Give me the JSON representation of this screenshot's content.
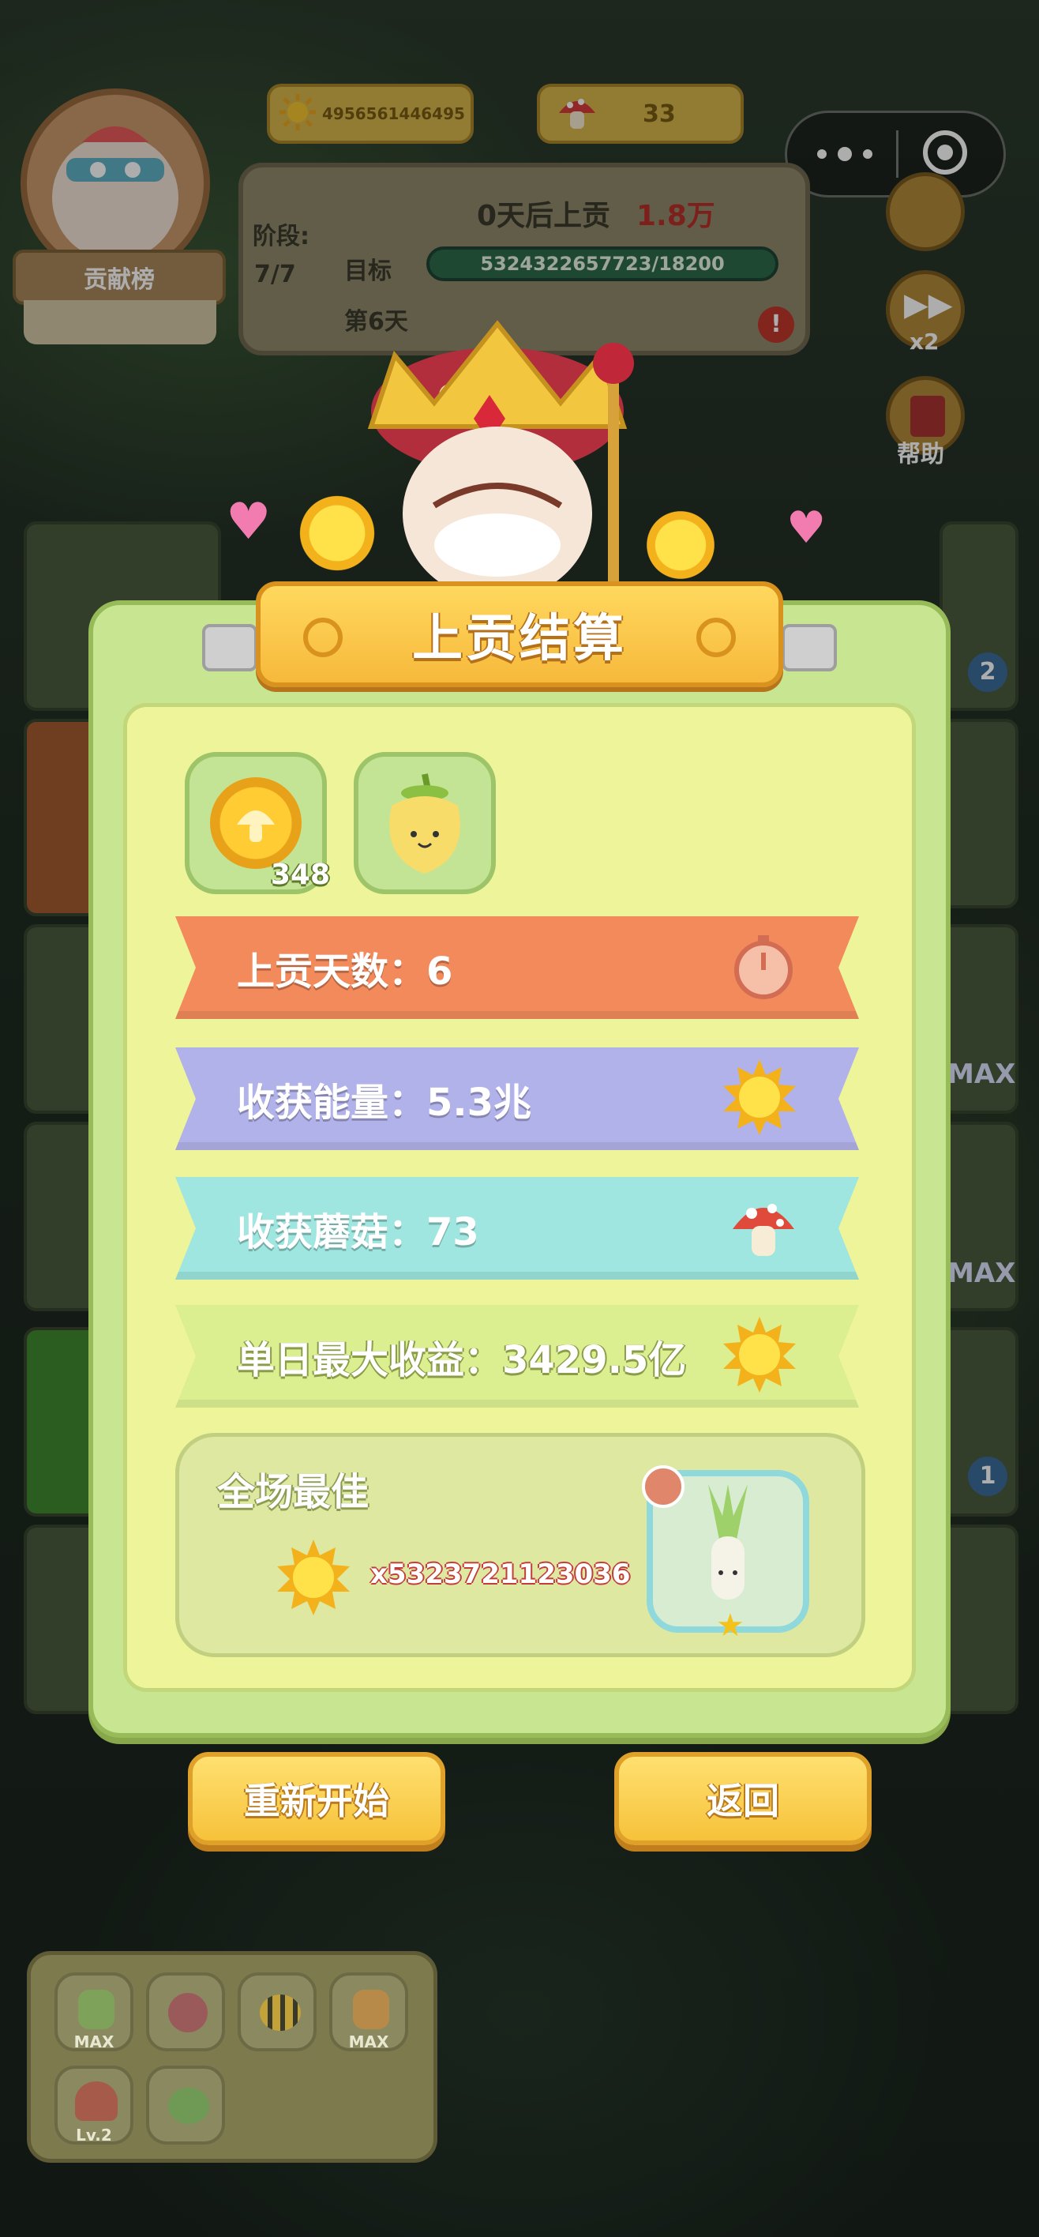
{
  "hud": {
    "energy": "4956561446495",
    "mushrooms": "33",
    "leaderboard_label": "贡献榜",
    "stage_label": "阶段:",
    "stage_value": "7/7",
    "tribute_countdown_prefix": "0天后上贡",
    "tribute_amount": "1.8万",
    "target_label": "目标",
    "target_progress": "5324322657723/18200",
    "day_label": "第6天",
    "speed_label": "x2",
    "help_label": "帮助",
    "right_badges": [
      "2",
      "MAX",
      "MAX",
      "1"
    ]
  },
  "settlement": {
    "title": "上贡结算",
    "rewards": [
      {
        "icon": "mushroom-coin-icon",
        "count": "348"
      },
      {
        "icon": "pepper-icon",
        "count": ""
      }
    ],
    "rows": [
      {
        "label": "上贡天数：6",
        "icon": "stopwatch-icon",
        "color": "#f08a5a"
      },
      {
        "label": "收获能量：5.3兆",
        "icon": "sun-icon",
        "color": "#b4b4ea"
      },
      {
        "label": "收获蘑菇：73",
        "icon": "mushroom-icon",
        "color": "#9ee7e0"
      },
      {
        "label": "单日最大收益：3429.5亿",
        "icon": "sun-icon",
        "color": "#d9ec8c"
      }
    ],
    "best": {
      "title": "全场最佳",
      "value": "x5323721123036"
    },
    "restart_label": "重新开始",
    "back_label": "返回"
  },
  "bottom_bar": {
    "items": [
      {
        "icon": "plant-icon",
        "label": "MAX"
      },
      {
        "icon": "fruit-icon",
        "label": ""
      },
      {
        "icon": "bee-icon",
        "label": ""
      },
      {
        "icon": "carrot-icon",
        "label": "MAX"
      },
      {
        "icon": "mushroom-pair-icon",
        "label": "Lv.2"
      },
      {
        "icon": "frog-icon",
        "label": ""
      }
    ]
  }
}
